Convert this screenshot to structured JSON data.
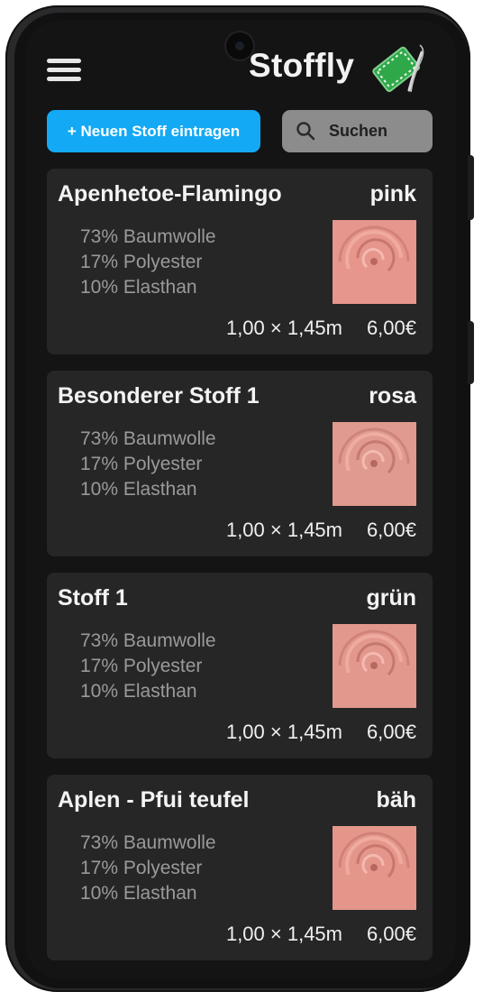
{
  "header": {
    "app_title": "Stoffly",
    "menu_icon": "hamburger-menu-icon",
    "logo_icon": "fabric-needle-logo-icon"
  },
  "toolbar": {
    "add_label": "+ Neuen Stoff eintragen",
    "search_label": "Suchen",
    "search_icon": "search-icon",
    "accent_color": "#14a9f4"
  },
  "fabrics": [
    {
      "name": "Apenhetoe-Flamingo",
      "color": "pink",
      "composition": [
        "73% Baumwolle",
        "17% Polyester",
        "10% Elasthan"
      ],
      "dimensions": "1,00 × 1,45m",
      "price": "6,00€"
    },
    {
      "name": "Besonderer Stoff 1",
      "color": "rosa",
      "composition": [
        "73% Baumwolle",
        "17% Polyester",
        "10% Elasthan"
      ],
      "dimensions": "1,00 × 1,45m",
      "price": "6,00€"
    },
    {
      "name": "Stoff 1",
      "color": "grün",
      "composition": [
        "73% Baumwolle",
        "17% Polyester",
        "10% Elasthan"
      ],
      "dimensions": "1,00 × 1,45m",
      "price": "6,00€"
    },
    {
      "name": "Aplen - Pfui teufel",
      "color": "bäh",
      "composition": [
        "73% Baumwolle",
        "17% Polyester",
        "10% Elasthan"
      ],
      "dimensions": "1,00 × 1,45m",
      "price": "6,00€"
    }
  ]
}
